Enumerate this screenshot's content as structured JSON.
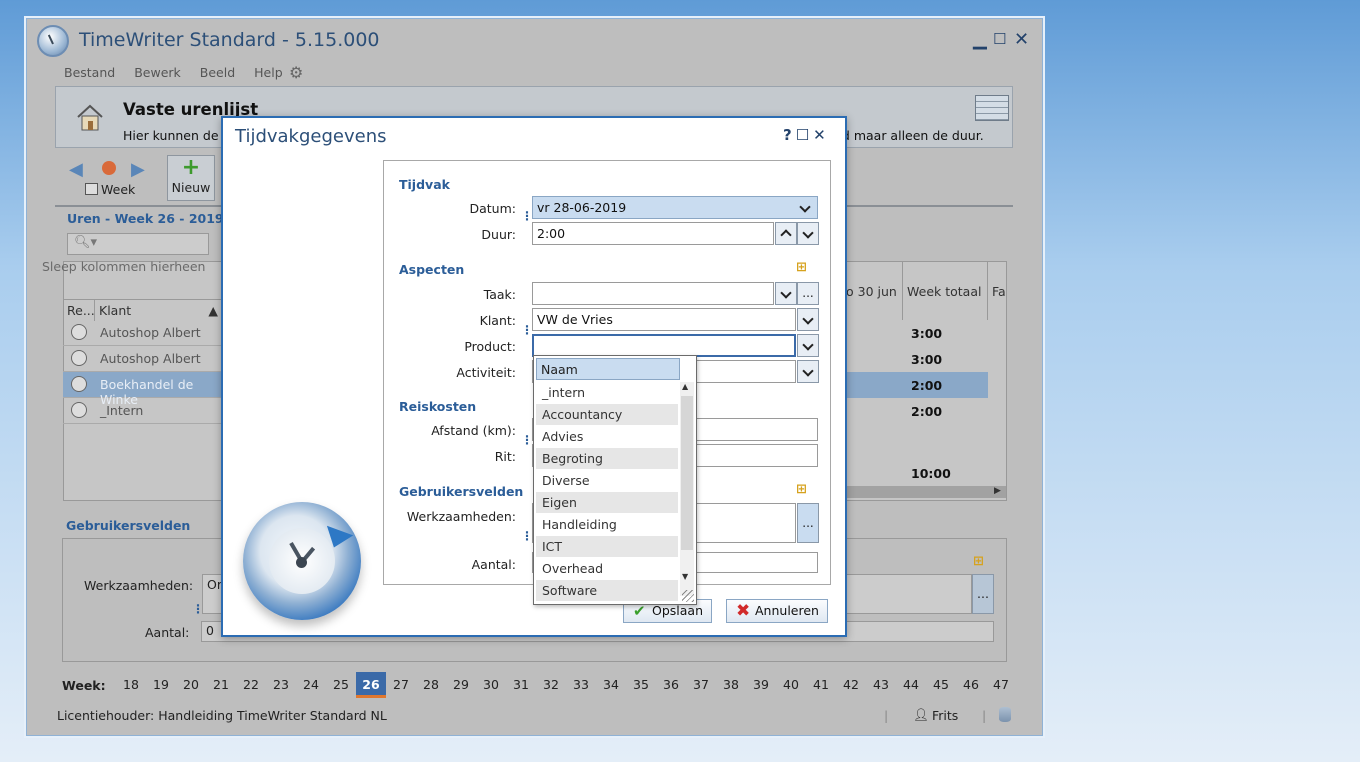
{
  "app": {
    "title": "TimeWriter Standard - 5.15.000",
    "menu": [
      "Bestand",
      "Bewerk",
      "Beeld",
      "Help"
    ],
    "window_controls": {
      "minimize": "▁",
      "maximize": "☐",
      "close": "✕"
    }
  },
  "banner": {
    "title": "Vaste urenlijst",
    "desc_left": "Hier kunnen de w",
    "desc_right": "rd maar alleen de duur."
  },
  "toolbar": {
    "week_label": "Week",
    "new_label": "Nieuw"
  },
  "uren": {
    "title": "Uren - Week  26 - 2019",
    "search_placeholder": "",
    "drag_hint": "Sleep kolommen hierheen",
    "columns": {
      "re": "Re...",
      "klant": "Klant",
      "ma": "o 30 jun",
      "weektotaal": "Week totaal",
      "fa": "Fa"
    },
    "rows": [
      {
        "klant": "Autoshop Albert",
        "total": "3:00"
      },
      {
        "klant": "Autoshop Albert",
        "total": "3:00"
      },
      {
        "klant": "Boekhandel de Winke",
        "total": "2:00"
      },
      {
        "klant": "_Intern",
        "total": "2:00"
      }
    ],
    "grand_total": "10:00"
  },
  "gebruikersvelden": {
    "title": "Gebruikersvelden",
    "werkzaamheden_label": "Werkzaamheden:",
    "werkzaamheden_value": "Or",
    "aantal_label": "Aantal:",
    "aantal_value": "0",
    "ellipsis": "..."
  },
  "weekbar": {
    "label": "Week:",
    "weeks": [
      "18",
      "19",
      "20",
      "21",
      "22",
      "23",
      "24",
      "25",
      "26",
      "27",
      "28",
      "29",
      "30",
      "31",
      "32",
      "33",
      "34",
      "35",
      "36",
      "37",
      "38",
      "39",
      "40",
      "41",
      "42",
      "43",
      "44",
      "45",
      "46",
      "47"
    ],
    "current": "26"
  },
  "status": {
    "license": "Licentiehouder: Handleiding TimeWriter Standard NL",
    "user": "Frits"
  },
  "dialog": {
    "title": "Tijdvakgegevens",
    "controls": "?☐✕",
    "sections": {
      "tijdvak": "Tijdvak",
      "aspecten": "Aspecten",
      "reiskosten": "Reiskosten",
      "gebruikersvelden": "Gebruikersvelden"
    },
    "labels": {
      "datum": "Datum:",
      "duur": "Duur:",
      "taak": "Taak:",
      "klant": "Klant:",
      "product": "Product:",
      "activiteit": "Activiteit:",
      "afstand": "Afstand (km):",
      "rit": "Rit:",
      "werkzaamheden": "Werkzaamheden:",
      "aantal": "Aantal:"
    },
    "values": {
      "datum": "vr 28-06-2019",
      "duur": "2:00",
      "taak": "",
      "klant": "VW de Vries",
      "product": ""
    },
    "ellipsis": "...",
    "dropdown": {
      "header": "Naam",
      "items": [
        "_intern",
        "Accountancy",
        "Advies",
        "Begroting",
        "Diverse",
        "Eigen",
        "Handleiding",
        "ICT",
        "Overhead",
        "Software"
      ]
    },
    "buttons": {
      "save": "Opslaan",
      "cancel": "Annuleren"
    }
  }
}
